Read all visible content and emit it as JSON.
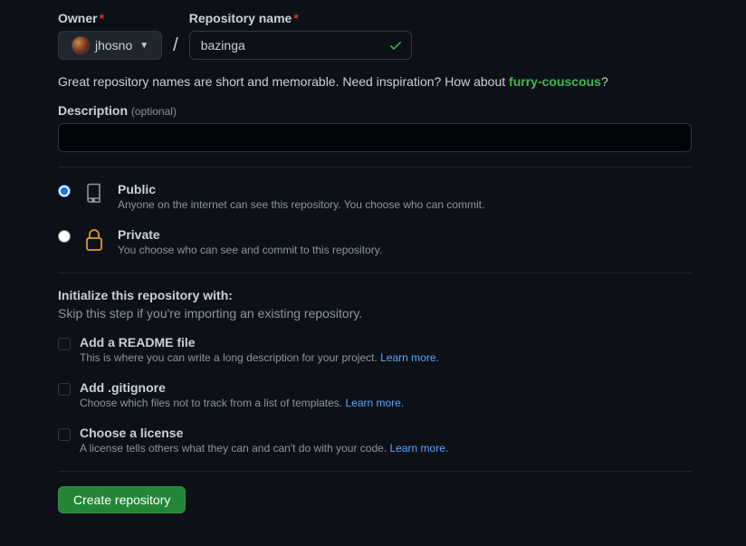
{
  "owner": {
    "label": "Owner",
    "username": "jhosno"
  },
  "repoName": {
    "label": "Repository name",
    "value": "bazinga"
  },
  "hint": {
    "prefix": "Great repository names are short and memorable. Need inspiration? How about ",
    "suggestion": "furry-couscous",
    "suffix": "?"
  },
  "description": {
    "label": "Description",
    "optional": "(optional)",
    "value": ""
  },
  "visibility": {
    "public": {
      "title": "Public",
      "desc": "Anyone on the internet can see this repository. You choose who can commit."
    },
    "private": {
      "title": "Private",
      "desc": "You choose who can see and commit to this repository."
    }
  },
  "initialize": {
    "title": "Initialize this repository with:",
    "subtitle": "Skip this step if you're importing an existing repository.",
    "readme": {
      "title": "Add a README file",
      "desc": "This is where you can write a long description for your project. ",
      "link": "Learn more."
    },
    "gitignore": {
      "title": "Add .gitignore",
      "desc": "Choose which files not to track from a list of templates. ",
      "link": "Learn more."
    },
    "license": {
      "title": "Choose a license",
      "desc": "A license tells others what they can and can't do with your code. ",
      "link": "Learn more."
    }
  },
  "submit": "Create repository"
}
